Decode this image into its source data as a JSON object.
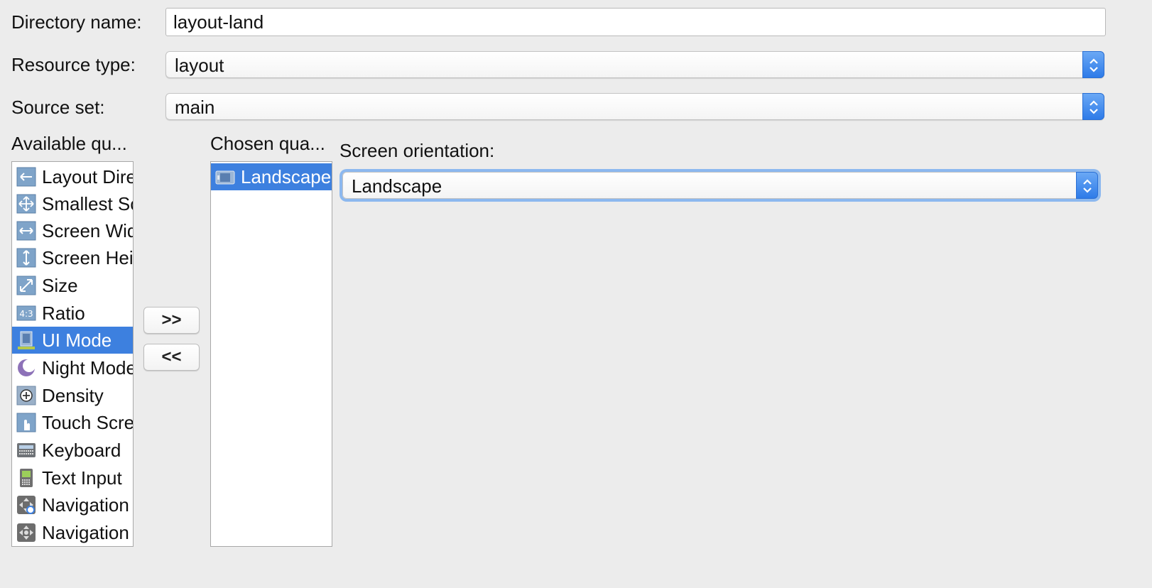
{
  "directory": {
    "label": "Directory name:",
    "value": "layout-land"
  },
  "resource_type": {
    "label": "Resource type:",
    "value": "layout"
  },
  "source_set": {
    "label": "Source set:",
    "value": "main"
  },
  "available": {
    "label": "Available qu...",
    "items": [
      {
        "label": "Layout Direction",
        "icon": "layout-direction-icon"
      },
      {
        "label": "Smallest Screen Width",
        "icon": "smallest-screen-width-icon"
      },
      {
        "label": "Screen Width",
        "icon": "screen-width-icon"
      },
      {
        "label": "Screen Height",
        "icon": "screen-height-icon"
      },
      {
        "label": "Size",
        "icon": "size-icon"
      },
      {
        "label": "Ratio",
        "icon": "ratio-icon"
      },
      {
        "label": "UI Mode",
        "icon": "ui-mode-icon",
        "selected": true
      },
      {
        "label": "Night Mode",
        "icon": "night-mode-icon"
      },
      {
        "label": "Density",
        "icon": "density-icon"
      },
      {
        "label": "Touch Screen",
        "icon": "touch-screen-icon"
      },
      {
        "label": "Keyboard",
        "icon": "keyboard-icon"
      },
      {
        "label": "Text Input",
        "icon": "text-input-icon"
      },
      {
        "label": "Navigation State",
        "icon": "navigation-state-icon"
      },
      {
        "label": "Navigation Method",
        "icon": "navigation-method-icon"
      }
    ]
  },
  "buttons": {
    "add": ">>",
    "remove": "<<"
  },
  "chosen": {
    "label": "Chosen qua...",
    "items": [
      {
        "label": "Landscape",
        "icon": "landscape-orientation-icon",
        "selected": true
      }
    ]
  },
  "orientation": {
    "label": "Screen orientation:",
    "value": "Landscape"
  },
  "colors": {
    "selection": "#3d80df",
    "combo_arrow": "#2e7be8",
    "focus_ring": "#8cb8ef"
  }
}
